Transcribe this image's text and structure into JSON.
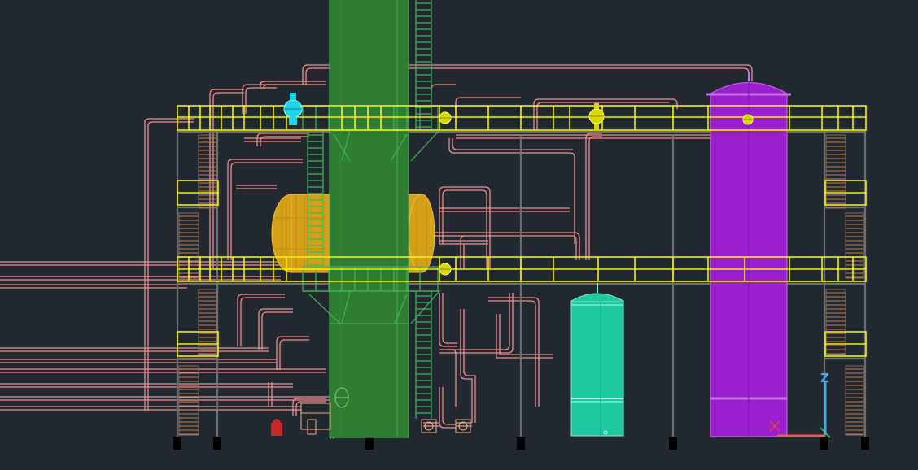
{
  "scene": {
    "background": "#212830",
    "colors": {
      "piping": "#ef8f8f",
      "handrail": "#f6f000",
      "column": "#2e7d32",
      "column_ladder": "#3fb85a",
      "horizontal_drum": "#d4a017",
      "vertical_tank_small": "#1ec9a0",
      "vertical_tank_tall": "#9c1fcf",
      "valves_cyan": "#1fd4e6",
      "pumps_red": "#c62828",
      "stair": "#c0825a",
      "steel": "#6a6f73"
    },
    "icons": {
      "ucs_icon": "ucs-axis-icon",
      "ucs_z_label": "Z"
    }
  }
}
